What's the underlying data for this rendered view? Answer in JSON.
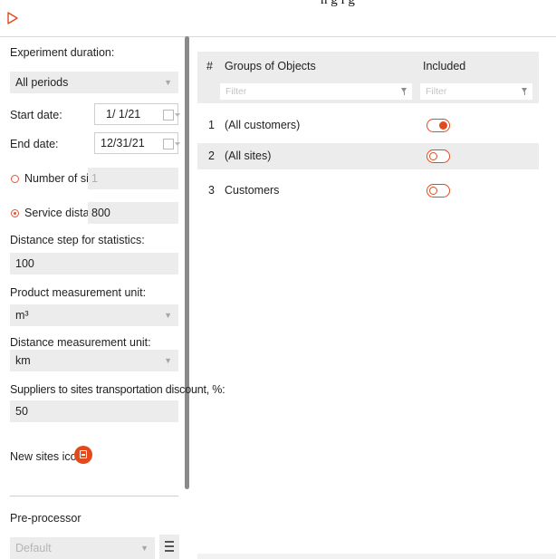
{
  "window": {
    "title_partial": "n g l g"
  },
  "settings": {
    "experiment_duration": {
      "label": "Experiment duration:",
      "value": "All periods"
    },
    "start_date": {
      "label": "Start date:",
      "value": "1/ 1/21"
    },
    "end_date": {
      "label": "End date:",
      "value": "12/31/21"
    },
    "number_of_sites": {
      "label": "Number of sites:",
      "value": "1",
      "selected": false
    },
    "service_distance": {
      "label": "Service distance:",
      "value": "800",
      "selected": true
    },
    "distance_step": {
      "label": "Distance step for statistics:",
      "value": "100"
    },
    "product_unit": {
      "label": "Product measurement unit:",
      "value": "m³"
    },
    "distance_unit": {
      "label": "Distance measurement unit:",
      "value": "km"
    },
    "transport_discount": {
      "label": "Suppliers to sites transportation discount, %:",
      "value": "50"
    },
    "new_sites_icon": {
      "label": "New sites icon:",
      "icon": "site-building-icon"
    },
    "pre_processor": {
      "label": "Pre-processor",
      "value": "Default"
    }
  },
  "table": {
    "columns": [
      "#",
      "Groups of Objects",
      "Included"
    ],
    "filter_placeholder": "Filter",
    "rows": [
      {
        "num": "1",
        "name": "(All customers)",
        "included": true
      },
      {
        "num": "2",
        "name": "(All sites)",
        "included": false
      },
      {
        "num": "3",
        "name": "Customers",
        "included": false
      }
    ]
  },
  "colors": {
    "accent": "#e24a1e",
    "field_bg": "#ececec"
  }
}
